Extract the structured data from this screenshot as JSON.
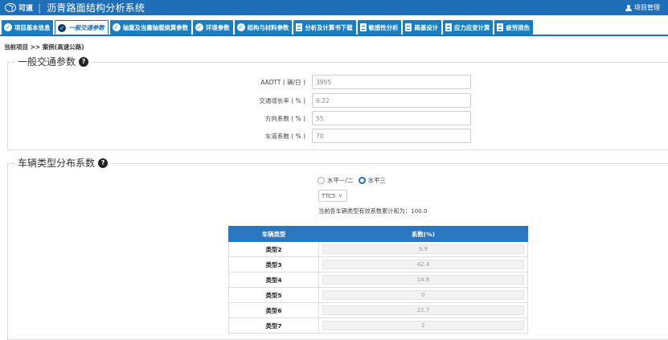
{
  "header": {
    "logo_text": "可道",
    "separator": "|",
    "title": "沥青路面结构分析系统",
    "project_manage": "项目管理"
  },
  "tabs": [
    {
      "label": "项目基本信息",
      "icon": "check-circle-icon",
      "active": false
    },
    {
      "label": "一般交通参数",
      "icon": "check-circle-icon",
      "active": true
    },
    {
      "label": "轴重及当量轴载换算参数",
      "icon": "check-circle-icon",
      "active": false
    },
    {
      "label": "环境参数",
      "icon": "check-circle-icon",
      "active": false
    },
    {
      "label": "结构与材料参数",
      "icon": "check-circle-icon",
      "active": false
    },
    {
      "label": "分析及计算书下载",
      "icon": "document-icon",
      "active": false
    },
    {
      "label": "敏感性分析",
      "icon": "document-icon",
      "active": false
    },
    {
      "label": "路基设计",
      "icon": "document-icon",
      "active": false
    },
    {
      "label": "应力应变计算",
      "icon": "document-icon",
      "active": false
    },
    {
      "label": "疲劳损伤",
      "icon": "document-icon",
      "active": false
    }
  ],
  "breadcrumb": "当前项目 >> 案例(高速公路)",
  "traffic": {
    "title": "一般交通参数",
    "fields": [
      {
        "label": "AADTT ( 辆/日 )",
        "value": "3995"
      },
      {
        "label": "交通增长率 ( % )",
        "value": "6.22"
      },
      {
        "label": "方向系数 ( % )",
        "value": "55"
      },
      {
        "label": "车道系数 ( % )",
        "value": "70"
      }
    ]
  },
  "vehicle": {
    "title": "车辆类型分布系数",
    "radio1": "水平一/二",
    "radio2": "水平三",
    "select_value": "TTC5",
    "sum_text": "当前各车辆类型有效系数累计和为：100.0",
    "table": {
      "col1": "车辆类型",
      "col2": "系数(%)",
      "rows": [
        {
          "type": "类型2",
          "value": "9.9"
        },
        {
          "type": "类型3",
          "value": "42.4"
        },
        {
          "type": "类型4",
          "value": "14.8"
        },
        {
          "type": "类型5",
          "value": "0"
        },
        {
          "type": "类型6",
          "value": "22.7"
        },
        {
          "type": "类型7",
          "value": "2"
        }
      ]
    }
  }
}
